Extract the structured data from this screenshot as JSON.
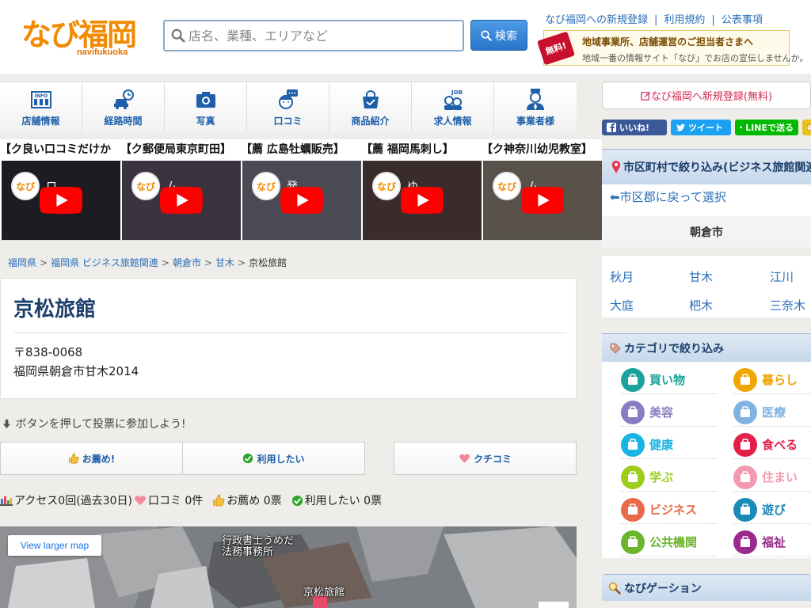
{
  "header": {
    "logo_text": "なび福岡",
    "logo_sub": "navifukuoka",
    "search_placeholder": "店名、業種、エリアなど",
    "search_button": "検索",
    "links": [
      "なび福岡への新規登録",
      "利用規約",
      "公表事項"
    ],
    "ad_badge": "無料!",
    "ad_line1": "地域事業所、店舗運営のご担当者さまへ",
    "ad_line2": "地域一番の情報サイト「なび」でお店の宣伝しませんか。"
  },
  "menu": [
    {
      "label": "店舗情報",
      "icon": "info-icon"
    },
    {
      "label": "経路時間",
      "icon": "car-clock-icon"
    },
    {
      "label": "写真",
      "icon": "camera-icon"
    },
    {
      "label": "口コミ",
      "icon": "chat-face-icon"
    },
    {
      "label": "商品紹介",
      "icon": "shopping-bag-icon"
    },
    {
      "label": "求人情報",
      "icon": "job-icon"
    },
    {
      "label": "事業者様",
      "icon": "business-person-icon"
    }
  ],
  "videos": [
    {
      "title": "【ク良い口コミだけか",
      "caption": "ロ…",
      "bg": "#1c1c22"
    },
    {
      "title": "【ク郵便局東京町田】",
      "caption": "ム…",
      "bg": "#3b3340"
    },
    {
      "title": "【薦 広島牡蠣販売】",
      "caption": "発…",
      "bg": "#4a4a55"
    },
    {
      "title": "【薦 福岡馬刺し】",
      "caption": "ゆ…",
      "bg": "#3a2c2c"
    },
    {
      "title": "【ク神奈川幼児教室】",
      "caption": "ム…",
      "bg": "#58524a"
    }
  ],
  "breadcrumb": [
    "福岡県",
    "福岡県 ビジネス旅館関連",
    "朝倉市",
    "甘木",
    "京松旅館"
  ],
  "business": {
    "name": "京松旅館",
    "postal": "〒838-0068",
    "address": "福岡県朝倉市甘木2014"
  },
  "vote": {
    "prompt": "ボタンを押して投票に参加しよう!",
    "recommend": "お薦め!",
    "want_to_use": "利用したい",
    "kuchikomi": "クチコミ"
  },
  "stats": {
    "access": "アクセス0回(過去30日)",
    "reviews": "口コミ 0件",
    "recommend": "お薦め 0票",
    "want": "利用したい 0票"
  },
  "map": {
    "larger_link": "View larger map",
    "label1": "行政書士うめだ",
    "label2": "法務事務所",
    "label3": "京松旅館"
  },
  "sidebar": {
    "register": "なび福岡へ新規登録(無料)",
    "share_fb": "いいね!",
    "share_tw": "ツイート",
    "share_line": "LINEで送る",
    "area_filter_title": "市区町村で絞り込み(ビジネス旅館関連)",
    "back_link": "⬅市区郡に戻って選択",
    "city": "朝倉市",
    "towns": [
      "秋月",
      "甘木",
      "江川",
      "大庭",
      "杷木",
      "三奈木"
    ],
    "category_title": "カテゴリで絞り込み",
    "categories": [
      {
        "label": "買い物",
        "color": "#1aa39a"
      },
      {
        "label": "暮らし",
        "color": "#f0a500"
      },
      {
        "label": "美容",
        "color": "#8a7cc2"
      },
      {
        "label": "医療",
        "color": "#7fb3e0"
      },
      {
        "label": "健康",
        "color": "#19b5e0"
      },
      {
        "label": "食べる",
        "color": "#e3204a"
      },
      {
        "label": "学ぶ",
        "color": "#9ccc1c"
      },
      {
        "label": "住まい",
        "color": "#f29ab2"
      },
      {
        "label": "ビジネス",
        "color": "#e86a4a"
      },
      {
        "label": "遊び",
        "color": "#1a8ab8"
      },
      {
        "label": "公共機関",
        "color": "#6ab52a"
      },
      {
        "label": "福祉",
        "color": "#9a2a8c"
      }
    ],
    "navigation_title": "なびゲーション"
  }
}
